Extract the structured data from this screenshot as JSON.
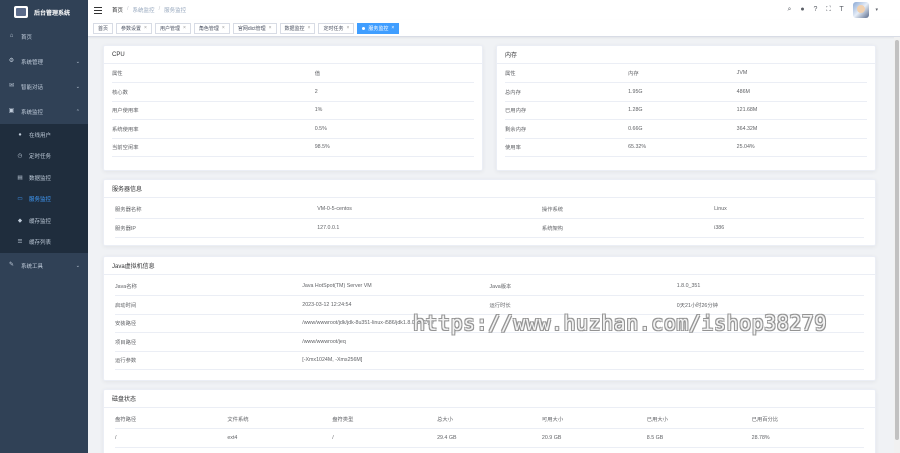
{
  "app": {
    "title": "后台管理系统"
  },
  "sidebar": {
    "items": [
      {
        "label": "首页",
        "icon": "dashboard-icon"
      },
      {
        "label": "系统管理",
        "icon": "gear-icon",
        "arrow": "⌄"
      },
      {
        "label": "智能对话",
        "icon": "chat-icon",
        "arrow": "⌄"
      },
      {
        "label": "系统监控",
        "icon": "monitor-icon",
        "arrow": "⌃"
      }
    ],
    "sub_items": [
      {
        "label": "在线用户",
        "icon": "online-icon"
      },
      {
        "label": "定时任务",
        "icon": "job-icon"
      },
      {
        "label": "数据监控",
        "icon": "druid-icon"
      },
      {
        "label": "服务监控",
        "icon": "server-icon",
        "active": true
      },
      {
        "label": "缓存监控",
        "icon": "redis-icon"
      },
      {
        "label": "缓存列表",
        "icon": "redis-list-icon"
      }
    ],
    "tools": {
      "label": "系统工具",
      "icon": "tool-icon",
      "arrow": "⌄"
    }
  },
  "navbar": {
    "breadcrumb": [
      "首页",
      "系统监控",
      "服务监控"
    ],
    "separator": "/",
    "caret": "▾"
  },
  "tags": [
    {
      "label": "首页"
    },
    {
      "label": "参数设置",
      "close": "×"
    },
    {
      "label": "用户管理",
      "close": "×"
    },
    {
      "label": "角色管理",
      "close": "×"
    },
    {
      "label": "官网dict管理",
      "close": "×"
    },
    {
      "label": "数据监控",
      "close": "×"
    },
    {
      "label": "定时任务",
      "close": "×"
    },
    {
      "label": "服务监控",
      "close": "×",
      "active": true
    }
  ],
  "cpu": {
    "title": "CPU",
    "rows": [
      [
        "属性",
        "值"
      ],
      [
        "核心数",
        "2"
      ],
      [
        "用户使用率",
        "1%"
      ],
      [
        "系统使用率",
        "0.5%"
      ],
      [
        "当前空闲率",
        "98.5%"
      ]
    ]
  },
  "memory": {
    "title": "内存",
    "rows": [
      [
        "属性",
        "内存",
        "JVM"
      ],
      [
        "总内存",
        "1.95G",
        "486M"
      ],
      [
        "已用内存",
        "1.28G",
        "121.68M"
      ],
      [
        "剩余内存",
        "0.66G",
        "364.32M"
      ],
      [
        "使用率",
        "65.32%",
        "25.04%"
      ]
    ]
  },
  "server": {
    "title": "服务器信息",
    "rows": [
      [
        "服务器名称",
        "VM-0-5-centos",
        "操作系统",
        "Linux"
      ],
      [
        "服务器IP",
        "127.0.0.1",
        "系统架构",
        "i386"
      ]
    ]
  },
  "jvm": {
    "title": "Java虚拟机信息",
    "rows": [
      [
        "Java名称",
        "Java HotSpot(TM) Server VM",
        "Java版本",
        "1.8.0_351"
      ],
      [
        "启动时间",
        "2023-03-12 12:24:54",
        "运行时长",
        "0天21小时26分钟"
      ]
    ],
    "wide_rows": [
      [
        "安装路径",
        "/www/wwwroot/jdk/jdk-8u351-linux-i586/jdk1.8.0_351/jre"
      ],
      [
        "项目路径",
        "/www/wwwroot/jeq"
      ],
      [
        "运行参数",
        "[-Xmx1024M, -Xms256M]"
      ]
    ]
  },
  "disk": {
    "title": "磁盘状态",
    "header": [
      "盘符路径",
      "文件系统",
      "盘符类型",
      "总大小",
      "可用大小",
      "已用大小",
      "已用百分比"
    ],
    "rows": [
      [
        "/",
        "ext4",
        "/",
        "29.4 GB",
        "20.9 GB",
        "8.5 GB",
        "28.78%"
      ]
    ]
  },
  "watermark": "https://www.huzhan.com/ishop38279",
  "colors": {
    "sidebar_bg": "#304156",
    "submenu_bg": "#1f2d3d",
    "accent": "#409eff"
  }
}
